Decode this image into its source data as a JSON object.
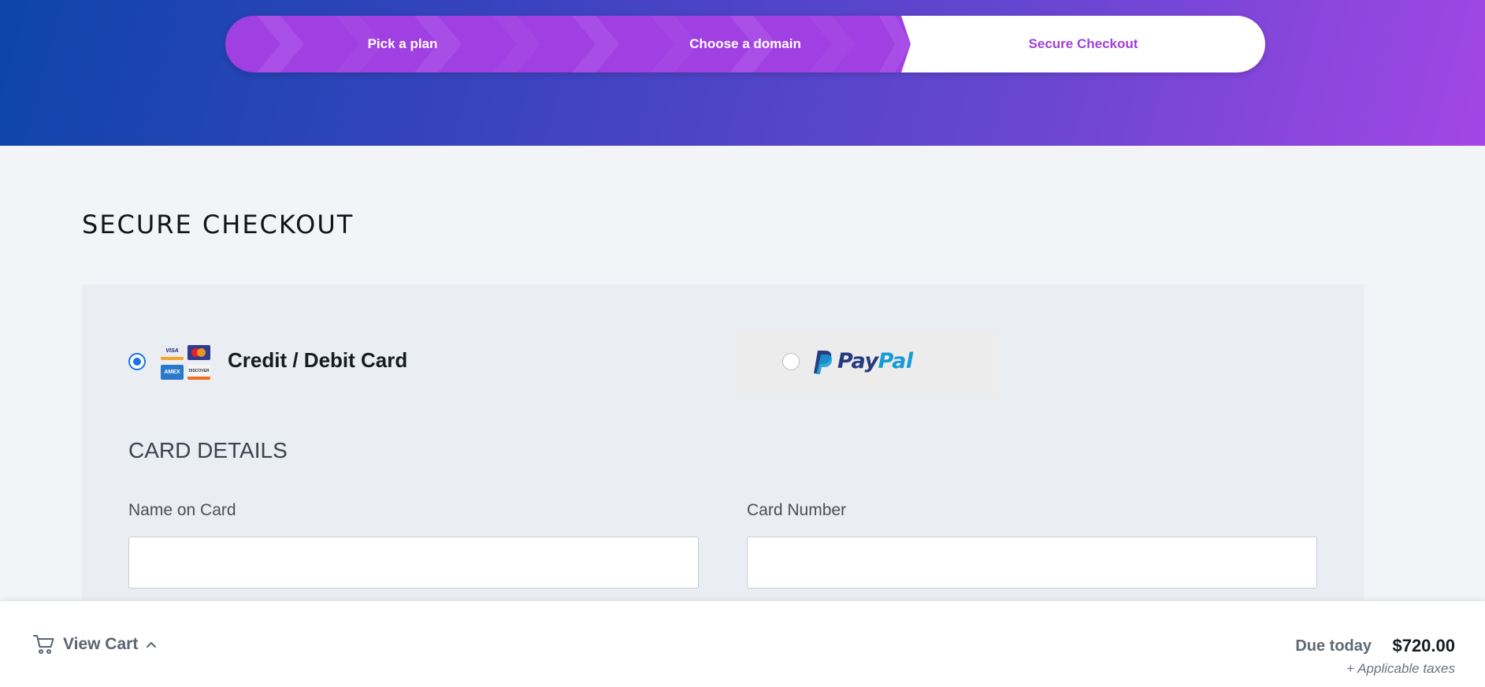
{
  "stepper": {
    "steps": [
      {
        "label": "Pick a plan",
        "state": "done"
      },
      {
        "label": "Choose a domain",
        "state": "done"
      },
      {
        "label": "Secure Checkout",
        "state": "active"
      }
    ]
  },
  "page": {
    "title": "SECURE CHECKOUT"
  },
  "payment": {
    "card_label": "Credit / Debit Card",
    "card_selected": true,
    "card_logos": [
      "VISA",
      "MC",
      "AMEX",
      "DISCOVER"
    ],
    "paypal_pay": "Pay",
    "paypal_pal": "Pal",
    "paypal_selected": false
  },
  "card_details": {
    "title": "CARD DETAILS",
    "name_label": "Name on Card",
    "name_value": "",
    "number_label": "Card Number",
    "number_value": ""
  },
  "footer": {
    "view_cart": "View Cart",
    "due_label": "Due today",
    "due_amount": "$720.00",
    "taxes": "+ Applicable taxes"
  },
  "colors": {
    "accent_purple": "#a13fd8",
    "radio_blue": "#1a73e8",
    "header_start": "#0d45aa",
    "header_end": "#a246e6"
  }
}
